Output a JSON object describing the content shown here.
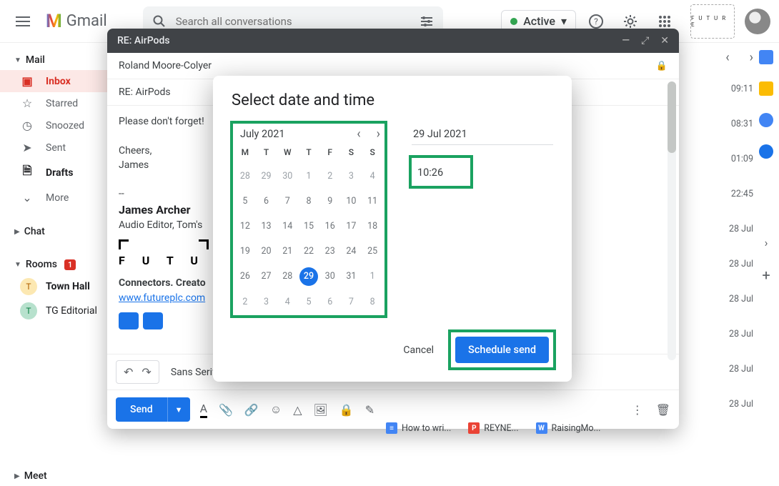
{
  "app": {
    "name": "Gmail"
  },
  "search": {
    "placeholder": "Search all conversations"
  },
  "status": {
    "label": "Active"
  },
  "sidebar": {
    "mail_label": "Mail",
    "items": [
      {
        "label": "Inbox"
      },
      {
        "label": "Starred"
      },
      {
        "label": "Snoozed"
      },
      {
        "label": "Sent"
      },
      {
        "label": "Drafts"
      },
      {
        "label": "More"
      }
    ],
    "chat_label": "Chat",
    "rooms_label": "Rooms",
    "rooms_badge": "1",
    "rooms": [
      {
        "letter": "T",
        "name": "Town Hall"
      },
      {
        "letter": "T",
        "name": "TG Editorial"
      }
    ],
    "meet_label": "Meet"
  },
  "inbox_times": [
    "09:11",
    "08:31",
    "01:09",
    "22:45",
    "28 Jul",
    "28 Jul",
    "28 Jul",
    "28 Jul",
    "28 Jul",
    "28 Jul"
  ],
  "compose": {
    "title": "RE: AirPods",
    "to": "Roland Moore-Colyer",
    "subject": "RE: AirPods",
    "body_line1": "Please don't forget!",
    "body_line2": "Cheers,",
    "body_line3": "James",
    "sig_sep": "--",
    "sig_name": "James Archer",
    "sig_role": "Audio Editor, Tom's",
    "sig_brand": "F U T U R E",
    "sig_tag": "Connectors. Creato",
    "sig_link": "www.futureplc.com",
    "font_name": "Sans Serif",
    "send_label": "Send"
  },
  "modal": {
    "title": "Select date and time",
    "month_label": "July 2021",
    "dow": [
      "M",
      "T",
      "W",
      "T",
      "F",
      "S",
      "S"
    ],
    "weeks": [
      [
        {
          "n": "28",
          "m": "p"
        },
        {
          "n": "29",
          "m": "p"
        },
        {
          "n": "30",
          "m": "p"
        },
        {
          "n": "1",
          "m": "c"
        },
        {
          "n": "2",
          "m": "c"
        },
        {
          "n": "3",
          "m": "c"
        },
        {
          "n": "4",
          "m": "c"
        }
      ],
      [
        {
          "n": "5"
        },
        {
          "n": "6"
        },
        {
          "n": "7"
        },
        {
          "n": "8"
        },
        {
          "n": "9"
        },
        {
          "n": "10"
        },
        {
          "n": "11"
        }
      ],
      [
        {
          "n": "12"
        },
        {
          "n": "13"
        },
        {
          "n": "14"
        },
        {
          "n": "15"
        },
        {
          "n": "16"
        },
        {
          "n": "17"
        },
        {
          "n": "18"
        }
      ],
      [
        {
          "n": "19"
        },
        {
          "n": "20"
        },
        {
          "n": "21"
        },
        {
          "n": "22"
        },
        {
          "n": "23"
        },
        {
          "n": "24"
        },
        {
          "n": "25"
        }
      ],
      [
        {
          "n": "26"
        },
        {
          "n": "27"
        },
        {
          "n": "28"
        },
        {
          "n": "29",
          "sel": true
        },
        {
          "n": "30"
        },
        {
          "n": "31"
        },
        {
          "n": "1",
          "m": "n"
        }
      ],
      [
        {
          "n": "2",
          "m": "n"
        },
        {
          "n": "3",
          "m": "n"
        },
        {
          "n": "4",
          "m": "n"
        },
        {
          "n": "5",
          "m": "n"
        },
        {
          "n": "6",
          "m": "n"
        },
        {
          "n": "7",
          "m": "n"
        },
        {
          "n": "8",
          "m": "n"
        }
      ]
    ],
    "date_value": "29 Jul 2021",
    "time_value": "10:26",
    "cancel_label": "Cancel",
    "schedule_label": "Schedule send"
  },
  "docstrip": [
    {
      "color": "#4285f4",
      "letter": "≡",
      "name": "How to wri..."
    },
    {
      "color": "#ea4335",
      "letter": "P",
      "name": "REYNE..."
    },
    {
      "color": "#4285f4",
      "letter": "W",
      "name": "RaisingMo..."
    }
  ]
}
